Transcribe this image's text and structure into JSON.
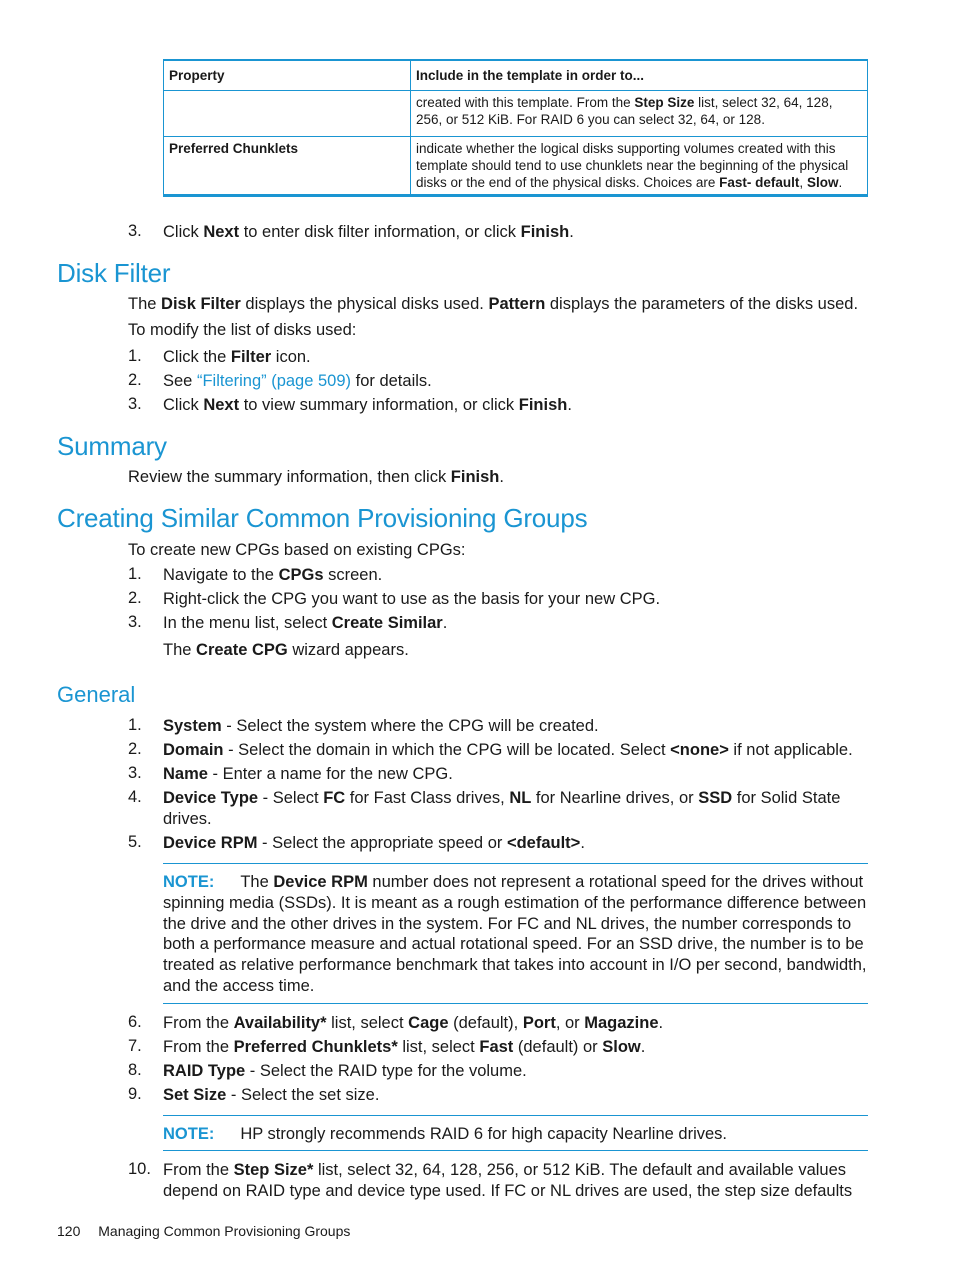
{
  "table": {
    "headers": [
      "Property",
      "Include in the template in order to..."
    ],
    "rows": [
      {
        "property": "",
        "parts": [
          {
            "t": "created with this template. From the "
          },
          {
            "t": "Step Size",
            "b": true
          },
          {
            "t": " list, select 32, 64, 128, 256, or 512 KiB. For RAID 6 you can select 32, 64, or 128."
          }
        ]
      },
      {
        "property": "Preferred Chunklets",
        "parts": [
          {
            "t": "indicate whether the logical disks supporting volumes created with this template should tend to use chunklets near the beginning of the physical disks or the end of the physical disks. Choices are "
          },
          {
            "t": "Fast- default",
            "b": true
          },
          {
            "t": ", "
          },
          {
            "t": "Slow",
            "b": true
          },
          {
            "t": "."
          }
        ]
      }
    ]
  },
  "step3_top": {
    "num": "3.",
    "parts": [
      {
        "t": "Click "
      },
      {
        "t": "Next",
        "b": true
      },
      {
        "t": " to enter disk filter information, or click "
      },
      {
        "t": "Finish",
        "b": true
      },
      {
        "t": "."
      }
    ]
  },
  "disk_filter": {
    "heading": "Disk Filter",
    "intro": [
      {
        "t": "The "
      },
      {
        "t": "Disk Filter",
        "b": true
      },
      {
        "t": " displays the physical disks used. "
      },
      {
        "t": "Pattern",
        "b": true
      },
      {
        "t": " displays the parameters of the disks used."
      }
    ],
    "lead": "To modify the list of disks used:",
    "steps": [
      {
        "num": "1.",
        "parts": [
          {
            "t": "Click the "
          },
          {
            "t": "Filter",
            "b": true
          },
          {
            "t": " icon."
          }
        ]
      },
      {
        "num": "2.",
        "parts": [
          {
            "t": "See "
          },
          {
            "t": "“Filtering” (page 509)",
            "link": true
          },
          {
            "t": " for details."
          }
        ]
      },
      {
        "num": "3.",
        "parts": [
          {
            "t": "Click "
          },
          {
            "t": "Next",
            "b": true
          },
          {
            "t": " to view summary information, or click "
          },
          {
            "t": "Finish",
            "b": true
          },
          {
            "t": "."
          }
        ]
      }
    ]
  },
  "summary": {
    "heading": "Summary",
    "text": [
      {
        "t": "Review the summary information, then click "
      },
      {
        "t": "Finish",
        "b": true
      },
      {
        "t": "."
      }
    ]
  },
  "creating": {
    "heading": "Creating Similar Common Provisioning Groups",
    "lead": "To create new CPGs based on existing CPGs:",
    "steps": [
      {
        "num": "1.",
        "parts": [
          {
            "t": "Navigate to the "
          },
          {
            "t": "CPGs",
            "b": true
          },
          {
            "t": " screen."
          }
        ]
      },
      {
        "num": "2.",
        "parts": [
          {
            "t": "Right-click the CPG you want to use as the basis for your new CPG."
          }
        ]
      },
      {
        "num": "3.",
        "parts": [
          {
            "t": "In the menu list, select "
          },
          {
            "t": "Create Similar",
            "b": true
          },
          {
            "t": "."
          }
        ]
      }
    ],
    "result": [
      {
        "t": "The "
      },
      {
        "t": "Create CPG",
        "b": true
      },
      {
        "t": " wizard appears."
      }
    ]
  },
  "general": {
    "heading": "General",
    "steps_a": [
      {
        "num": "1.",
        "parts": [
          {
            "t": "System",
            "b": true
          },
          {
            "t": " - Select the system where the CPG will be created."
          }
        ]
      },
      {
        "num": "2.",
        "parts": [
          {
            "t": "Domain",
            "b": true
          },
          {
            "t": " - Select the domain in which the CPG will be located. Select "
          },
          {
            "t": "<none>",
            "b": true
          },
          {
            "t": " if not applicable."
          }
        ]
      },
      {
        "num": "3.",
        "parts": [
          {
            "t": "Name",
            "b": true
          },
          {
            "t": " - Enter a name for the new CPG."
          }
        ]
      },
      {
        "num": "4.",
        "parts": [
          {
            "t": "Device Type",
            "b": true
          },
          {
            "t": " - Select "
          },
          {
            "t": "FC",
            "b": true
          },
          {
            "t": " for Fast Class drives, "
          },
          {
            "t": "NL",
            "b": true
          },
          {
            "t": " for Nearline drives, or "
          },
          {
            "t": "SSD",
            "b": true
          },
          {
            "t": " for Solid State drives."
          }
        ]
      },
      {
        "num": "5.",
        "parts": [
          {
            "t": "Device RPM",
            "b": true
          },
          {
            "t": " - Select the appropriate speed or "
          },
          {
            "t": "<default>",
            "b": true
          },
          {
            "t": "."
          }
        ]
      }
    ],
    "note1": {
      "label": "NOTE:",
      "parts": [
        {
          "t": "The "
        },
        {
          "t": "Device RPM",
          "b": true
        },
        {
          "t": " number does not represent a rotational speed for the drives without spinning media (SSDs). It is meant as a rough estimation of the performance difference between the drive and the other drives in the system. For FC and NL drives, the number corresponds to both a performance measure and actual rotational speed. For an SSD drive, the number is to be treated as relative performance benchmark that takes into account in I/O per second, bandwidth, and the access time."
        }
      ]
    },
    "steps_b": [
      {
        "num": "6.",
        "parts": [
          {
            "t": "From the "
          },
          {
            "t": "Availability*",
            "b": true
          },
          {
            "t": " list, select "
          },
          {
            "t": "Cage",
            "b": true
          },
          {
            "t": " (default), "
          },
          {
            "t": "Port",
            "b": true
          },
          {
            "t": ", or "
          },
          {
            "t": "Magazine",
            "b": true
          },
          {
            "t": "."
          }
        ]
      },
      {
        "num": "7.",
        "parts": [
          {
            "t": "From the "
          },
          {
            "t": "Preferred Chunklets*",
            "b": true
          },
          {
            "t": " list, select "
          },
          {
            "t": "Fast",
            "b": true
          },
          {
            "t": " (default) or "
          },
          {
            "t": "Slow",
            "b": true
          },
          {
            "t": "."
          }
        ]
      },
      {
        "num": "8.",
        "parts": [
          {
            "t": "RAID Type",
            "b": true
          },
          {
            "t": " - Select the RAID type for the volume."
          }
        ]
      },
      {
        "num": "9.",
        "parts": [
          {
            "t": "Set Size",
            "b": true
          },
          {
            "t": " - Select the set size."
          }
        ]
      }
    ],
    "note2": {
      "label": "NOTE:",
      "parts": [
        {
          "t": "HP strongly recommends RAID 6 for high capacity Nearline drives."
        }
      ]
    },
    "step10": {
      "num": "10.",
      "parts": [
        {
          "t": "From the "
        },
        {
          "t": "Step Size*",
          "b": true
        },
        {
          "t": " list, select 32, 64, 128, 256, or 512 KiB. The default and available values depend on RAID type and device type used. If FC or NL drives are used, the step size defaults"
        }
      ]
    }
  },
  "footer": {
    "page": "120",
    "title": "Managing Common Provisioning Groups"
  }
}
